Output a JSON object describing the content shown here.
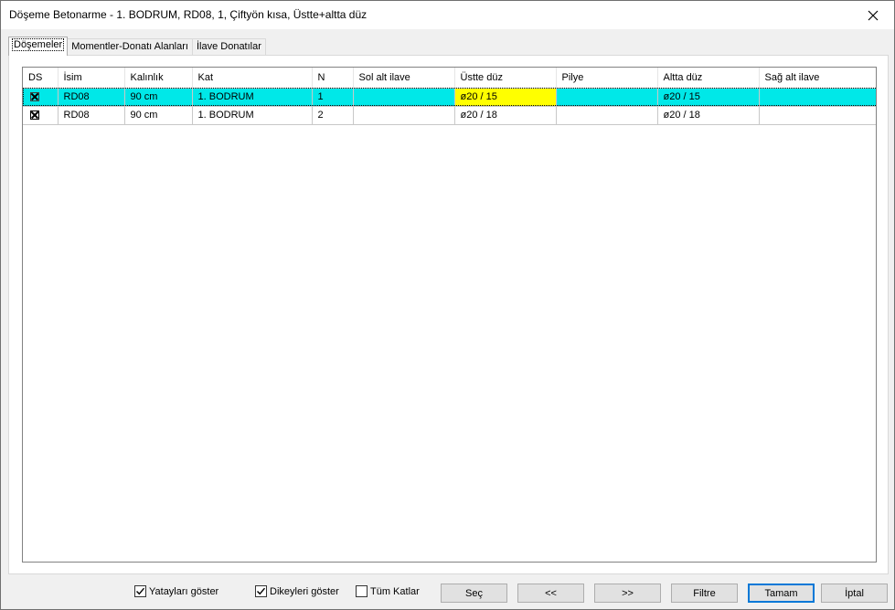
{
  "window": {
    "title": "Döşeme Betonarme - 1. BODRUM, RD08, 1, Çiftyön kısa, Üstte+altta düz"
  },
  "tabs": [
    {
      "label": "Döşemeler"
    },
    {
      "label": "Momentler-Donatı Alanları"
    },
    {
      "label": "İlave Donatılar"
    }
  ],
  "grid": {
    "columns": [
      "DS",
      "İsim",
      "Kalınlık",
      "Kat",
      "N",
      "Sol alt ilave",
      "Üstte düz",
      "Pilye",
      "Altta düz",
      "Sağ alt ilave"
    ],
    "rows": [
      {
        "ds_checked": true,
        "isim": "RD08",
        "kalinlik": "90 cm",
        "kat": "1. BODRUM",
        "n": "1",
        "sol_alt_ilave": "",
        "ustte_duz": "ø20 / 15",
        "pilye": "",
        "altta_duz": "ø20 / 15",
        "sag_alt_ilave": "",
        "selected": true
      },
      {
        "ds_checked": true,
        "isim": "RD08",
        "kalinlik": "90 cm",
        "kat": "1. BODRUM",
        "n": "2",
        "sol_alt_ilave": "",
        "ustte_duz": "ø20 / 18",
        "pilye": "",
        "altta_duz": "ø20 / 18",
        "sag_alt_ilave": "",
        "selected": false
      }
    ]
  },
  "footer": {
    "checkboxes": [
      {
        "label": "Yatayları göster",
        "checked": true
      },
      {
        "label": "Dikeyleri göster",
        "checked": true
      },
      {
        "label": "Tüm Katlar",
        "checked": false
      }
    ],
    "buttons": {
      "sec": "Seç",
      "prev": "<<",
      "next": ">>",
      "filtre": "Filtre",
      "tamam": "Tamam",
      "iptal": "İptal"
    }
  },
  "colors": {
    "selected_row": "#00e8e8",
    "focused_cell": "#ffff00",
    "default_button_border": "#0078d7"
  }
}
